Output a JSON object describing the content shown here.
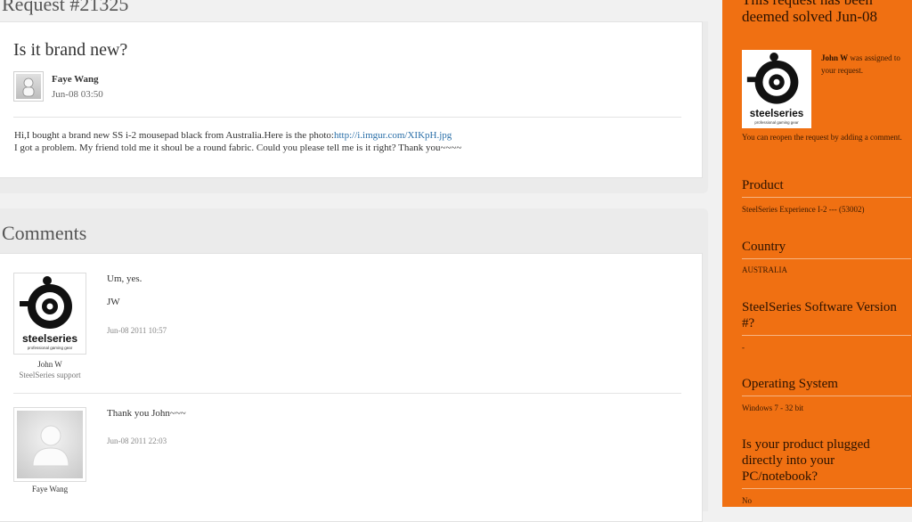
{
  "page": {
    "title": "Request #21325"
  },
  "request": {
    "heading": "Is it brand new?",
    "author": "Faye Wang",
    "date": "Jun-08 03:50",
    "body_text": "Hi,I bought a brand new SS i-2 mousepad black from Australia.Here is the photo:",
    "body_link": "http://i.imgur.com/XIKpH.jpg",
    "body_line2": "I got a problem. My friend told me it shoul be a round fabric. Could you please tell me is it right? Thank you~~~~"
  },
  "comments": {
    "title": "Comments",
    "items": [
      {
        "author": "John W",
        "role": "SteelSeries support",
        "lines": [
          "Um, yes.",
          "JW"
        ],
        "date": "Jun-08 2011 10:57",
        "avatar": "steelseries-logo"
      },
      {
        "author": "Faye Wang",
        "role": "",
        "lines": [
          "Thank you John~~~"
        ],
        "date": "Jun-08 2011 22:03",
        "avatar": "default-user"
      }
    ]
  },
  "sidebar": {
    "solved_title": "This request has been deemed solved Jun-08",
    "assignee": "John W",
    "assigned_text": " was assigned to your request.",
    "reopen_text": "You can reopen the request by adding a comment.",
    "logo_wordmark": "steelseries",
    "logo_tagline": "professional gaming gear",
    "fields": [
      {
        "label": "Product",
        "value": "SteelSeries Experience I-2 --- (53002)"
      },
      {
        "label": "Country",
        "value": "AUSTRALIA"
      },
      {
        "label": "SteelSeries Software Version #?",
        "value": "-"
      },
      {
        "label": "Operating System",
        "value": "Windows 7 - 32 bit"
      },
      {
        "label": "Is your product plugged directly into your PC/notebook?",
        "value": "No"
      }
    ]
  },
  "colors": {
    "sidebar_bg": "#f07012",
    "link": "#2a6fa8"
  }
}
